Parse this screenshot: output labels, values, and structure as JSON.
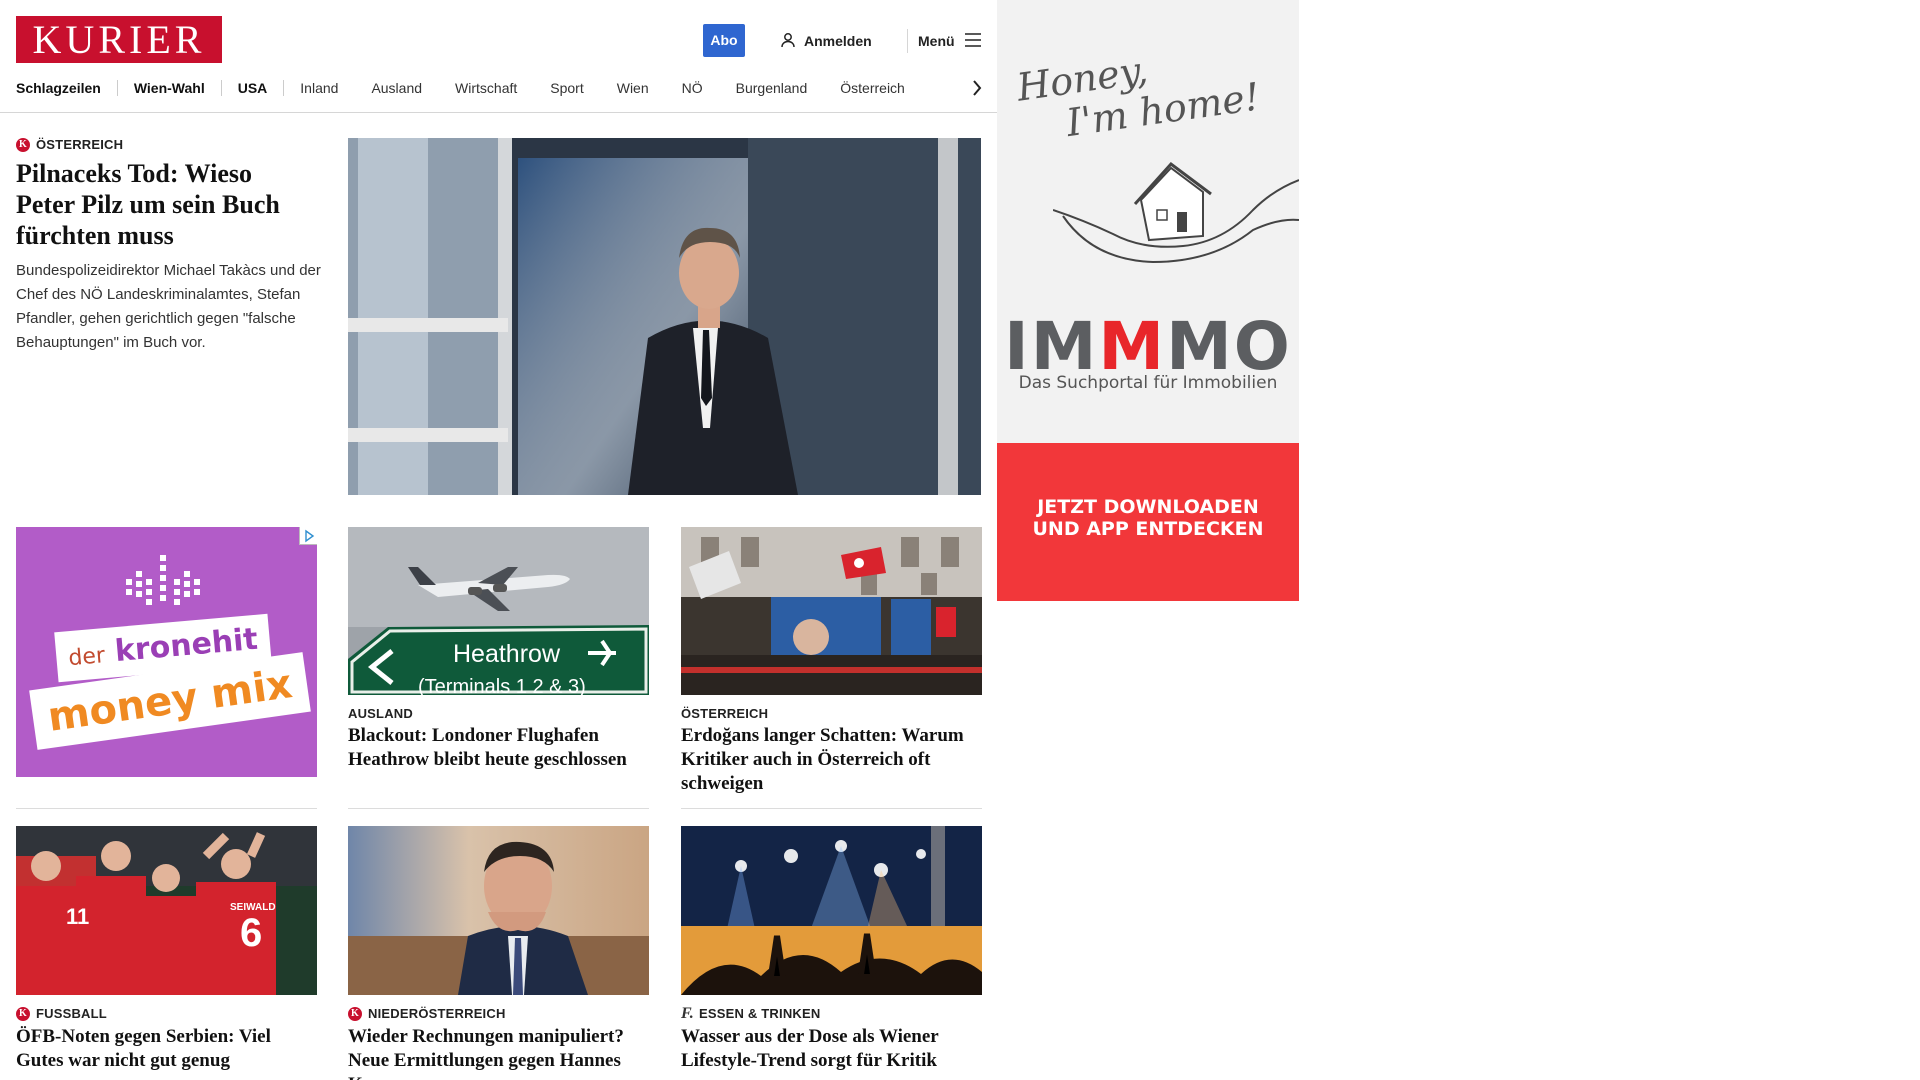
{
  "header": {
    "logo_text": "KURIER",
    "abo_label": "Abo",
    "login_label": "Anmelden",
    "menu_label": "Menü"
  },
  "nav": {
    "items": [
      {
        "label": "Schlagzeilen",
        "bold": true
      },
      {
        "label": "Wien-Wahl",
        "bold": true
      },
      {
        "label": "USA",
        "bold": true
      },
      {
        "label": "Inland",
        "bold": false
      },
      {
        "label": "Ausland",
        "bold": false
      },
      {
        "label": "Wirtschaft",
        "bold": false
      },
      {
        "label": "Sport",
        "bold": false
      },
      {
        "label": "Wien",
        "bold": false
      },
      {
        "label": "NÖ",
        "bold": false
      },
      {
        "label": "Burgenland",
        "bold": false
      },
      {
        "label": "Österreich",
        "bold": false
      }
    ]
  },
  "lead": {
    "kicker": "ÖSTERREICH",
    "headline": "Pilnaceks Tod: Wieso Peter Pilz um sein Buch fürchten muss",
    "teaser": "Bundespolizeidirektor Michael Takàcs und der Chef des NÖ Landeskriminalamtes, Stefan Pfandler, gehen gerichtlich gegen \"falsche Behauptungen\" im Buch vor."
  },
  "cards": [
    {
      "kicker": "AUSLAND",
      "headline": "Blackout: Londoner Flughafen Heathrow bleibt heute geschlossen",
      "badge": "none"
    },
    {
      "kicker": "ÖSTERREICH",
      "headline": "Erdoğans langer Schatten: Warum Kritiker auch in Österreich oft schweigen",
      "badge": "none"
    },
    {
      "kicker": "FUSSBALL",
      "headline": "ÖFB-Noten gegen Serbien: Viel Gutes war nicht gut genug",
      "badge": "k"
    },
    {
      "kicker": "NIEDERÖSTERREICH",
      "headline": "Wieder Rechnungen manipuliert? Neue Ermittlungen gegen Hannes Koza",
      "badge": "k"
    },
    {
      "kicker": "ESSEN & TRINKEN",
      "headline": "Wasser aus der Dose als Wiener Lifestyle-Trend sorgt für Kritik",
      "badge": "f"
    }
  ],
  "images": {
    "heathrow_sign": "Heathrow",
    "heathrow_terminals": "(Terminals 1 2 & 3)",
    "jersey_number_1": "11",
    "jersey_number_2": "6",
    "jersey_name": "SEIWALD"
  },
  "ad_krone": {
    "line1_small": "der",
    "line1_big": "kronehit",
    "line2": "money mix"
  },
  "ad_immo": {
    "script_line1": "Honey,",
    "script_line2": "I'm home!",
    "logo_part1": "IM",
    "logo_part2": "M",
    "logo_part3": "MO",
    "tagline": "Das Suchportal für Immobilien",
    "cta_line1": "JETZT DOWNLOADEN",
    "cta_line2": "UND APP ENTDECKEN"
  },
  "colors": {
    "brand_red": "#c8102e",
    "abo_blue": "#2f66d0",
    "immo_red": "#f2373a",
    "krone_purple": "#b25cc8"
  }
}
